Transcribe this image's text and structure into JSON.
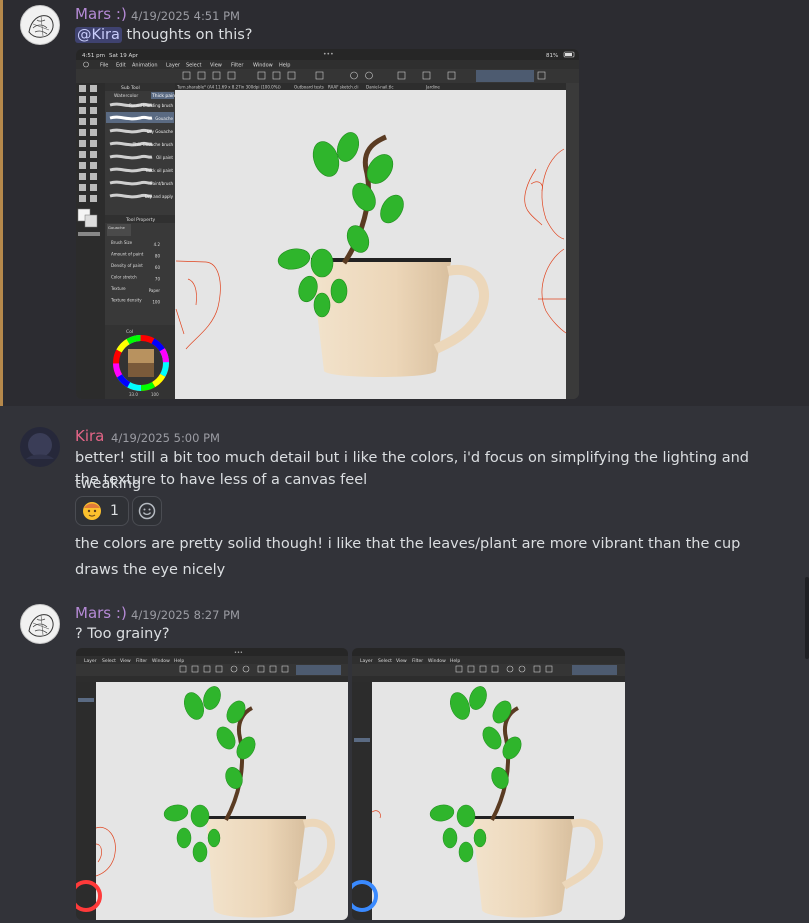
{
  "messages": [
    {
      "author": "Mars :)",
      "timestamp": "4/19/2025 4:51 PM",
      "mention": "@Kira",
      "text": "thoughts on this?",
      "attachment": {
        "status_time": "4:51 pm",
        "status_date": "Sat 19 Apr",
        "battery": "81%",
        "menu": [
          "File",
          "Edit",
          "Animation",
          "Layer",
          "Select",
          "View",
          "Filter",
          "Window",
          "Help"
        ],
        "tabs": [
          "Turn.sharable* (A4 11.69 x 8.27in 300dpi (100.0%))",
          "Outboard tests",
          "RAAF sketch.cli",
          "Daniel-nail.tlc",
          "Jardine"
        ],
        "brush_panel_title": "Sub Tool",
        "brush_tabs": [
          "Watercolor",
          "Thick paint"
        ],
        "brushes": [
          "Round blending brush",
          "Gouache",
          "Dry Gouache",
          "Thin Gouache brush",
          "Oil paint",
          "Thick oil paint",
          "Paint/brush",
          "Dry and apply"
        ],
        "tool_property_title": "Tool Property",
        "tool_property_tool": "Gouache",
        "properties": [
          {
            "label": "Brush Size",
            "value": "4.2"
          },
          {
            "label": "Amount of paint",
            "value": "80"
          },
          {
            "label": "Density of paint",
            "value": "60"
          },
          {
            "label": "Color stretch",
            "value": "70"
          },
          {
            "label": "Texture",
            "value": "Paper"
          },
          {
            "label": "Texture density",
            "value": "100"
          }
        ],
        "color_panel_label": "Col",
        "color_bottom_values": [
          "33.0",
          "100"
        ]
      }
    },
    {
      "author": "Kira",
      "timestamp": "4/19/2025 5:00 PM",
      "line1": "better! still a bit too much detail but i like the colors, i'd focus on simplifying the lighting and tweaking",
      "line2": "the texture to have less of a canvas feel",
      "reaction_count": "1",
      "line3": "the colors are pretty solid though! i like that the leaves/plant are more vibrant than the cup",
      "line4": "draws the eye nicely"
    },
    {
      "author": "Mars :)",
      "timestamp": "4/19/2025 8:27 PM",
      "text": "? Too grainy?",
      "menu": [
        "Layer",
        "Select",
        "View",
        "Filter",
        "Window",
        "Help"
      ]
    }
  ],
  "colors": {
    "mars": "#b58ad6",
    "kira": "#e46587",
    "background": "#323339",
    "highlight": "#2c2c31",
    "highlight_bar": "#b6894b",
    "leaf": "#2fb52c",
    "cup": "#efdcc1"
  },
  "icons": [
    "smiling-face-emoji-icon",
    "add-reaction-icon",
    "avatar-sketch-icon"
  ]
}
